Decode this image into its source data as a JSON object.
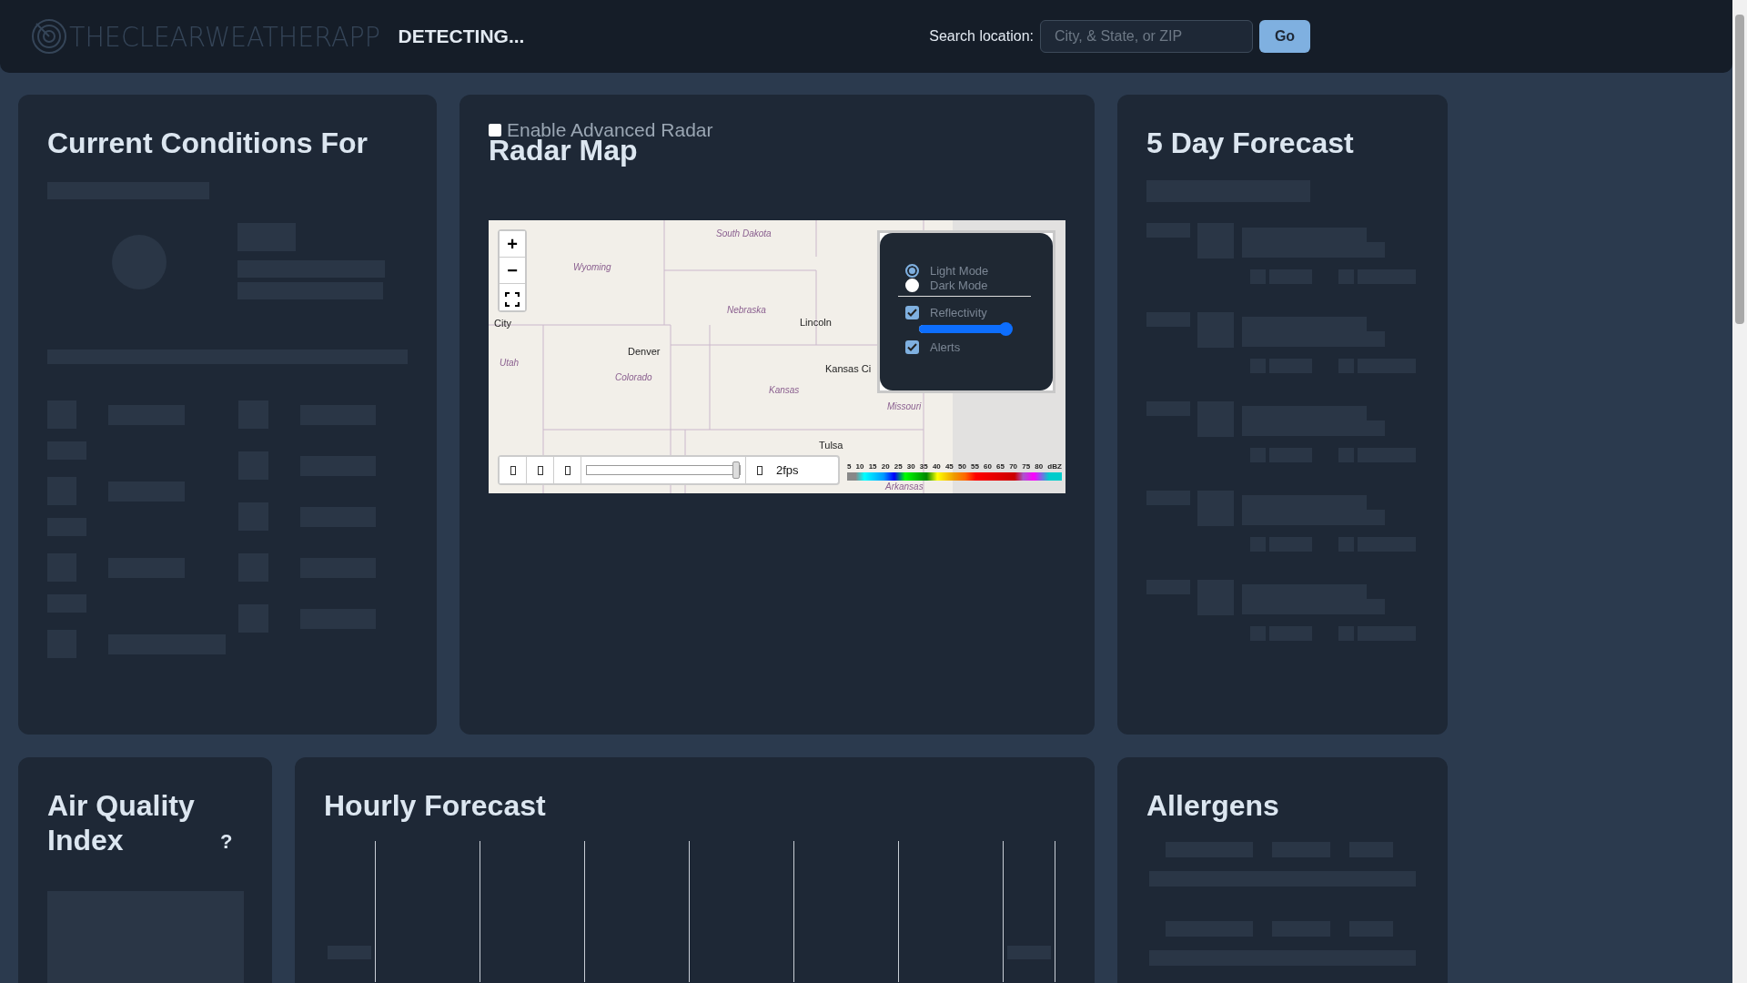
{
  "header": {
    "logo": "THECLEARWEATHERAPP",
    "location": "DETECTING...",
    "search": {
      "label": "Search location:",
      "placeholder": "City, & State, or ZIP",
      "button": "Go"
    }
  },
  "current": {
    "title": "Current Conditions For"
  },
  "radar": {
    "title": "Radar Map",
    "advanced": {
      "label": "Enable Advanced Radar",
      "checked": false
    },
    "zoom_in": "+",
    "zoom_out": "−",
    "map_labels": [
      {
        "text": "South Dakota",
        "kind": "region"
      },
      {
        "text": "Wyoming",
        "kind": "region"
      },
      {
        "text": "Nebraska",
        "kind": "region"
      },
      {
        "text": "Lincoln",
        "kind": "city"
      },
      {
        "text": "City",
        "kind": "city"
      },
      {
        "text": "Denver",
        "kind": "city"
      },
      {
        "text": "Utah",
        "kind": "region"
      },
      {
        "text": "Colorado",
        "kind": "region"
      },
      {
        "text": "Kansas",
        "kind": "region"
      },
      {
        "text": "Kansas Ci",
        "kind": "city"
      },
      {
        "text": "Missouri",
        "kind": "region"
      },
      {
        "text": "Tulsa",
        "kind": "city"
      },
      {
        "text": "Arkansas",
        "kind": "region"
      }
    ],
    "layer_panel": {
      "modes": [
        {
          "label": "Light Mode",
          "selected": true
        },
        {
          "label": "Dark Mode",
          "selected": false
        }
      ],
      "layers": [
        {
          "label": "Reflectivity",
          "checked": true,
          "kind": "slider",
          "level": 0.95
        },
        {
          "label": "Alerts",
          "checked": true,
          "kind": "plain"
        }
      ]
    },
    "playback": {
      "level": 1,
      "speed": "2fps"
    },
    "legend": {
      "labels": [
        "5",
        "10",
        "15",
        "20",
        "25",
        "30",
        "35",
        "40",
        "45",
        "50",
        "55",
        "60",
        "65",
        "70",
        "75",
        "80",
        "dBZ"
      ]
    }
  },
  "forecast": {
    "title": "5 Day Forecast"
  },
  "aqi": {
    "title": "Air Quality Index",
    "help": "?"
  },
  "hourly": {
    "title": "Hourly Forecast"
  },
  "allergens": {
    "title": "Allergens"
  }
}
